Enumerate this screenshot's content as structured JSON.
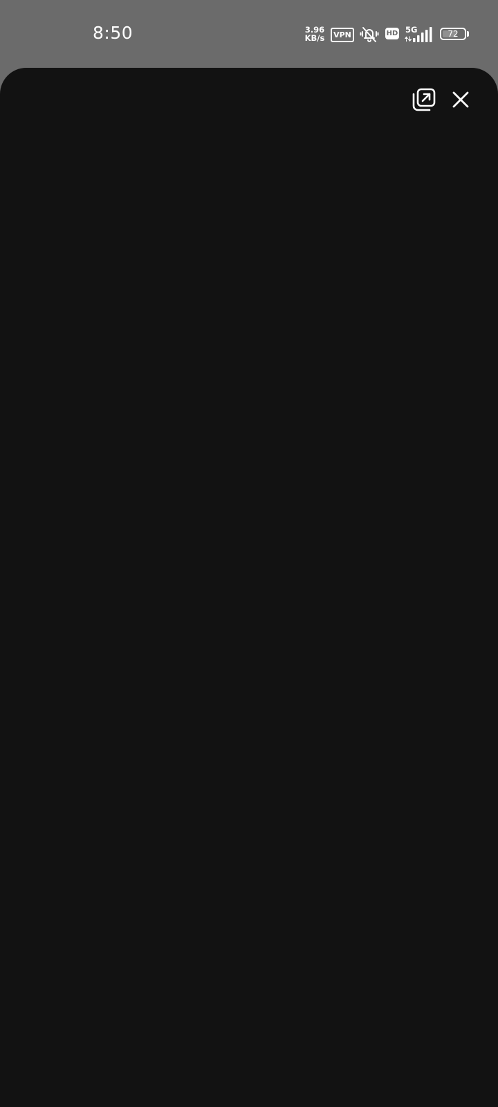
{
  "status_bar": {
    "time": "8:50",
    "net_speed_value": "3.96",
    "net_speed_unit": "KB/s",
    "vpn_label": "VPN",
    "hd_label": "HD",
    "network_type": "5G",
    "battery_level": "72",
    "battery_percent": 72,
    "icons": [
      "bell-off-icon",
      "signal-icon",
      "battery-icon"
    ]
  },
  "sheet": {
    "actions": [
      "open-external-icon",
      "close-icon"
    ],
    "background_color": "#121212"
  }
}
